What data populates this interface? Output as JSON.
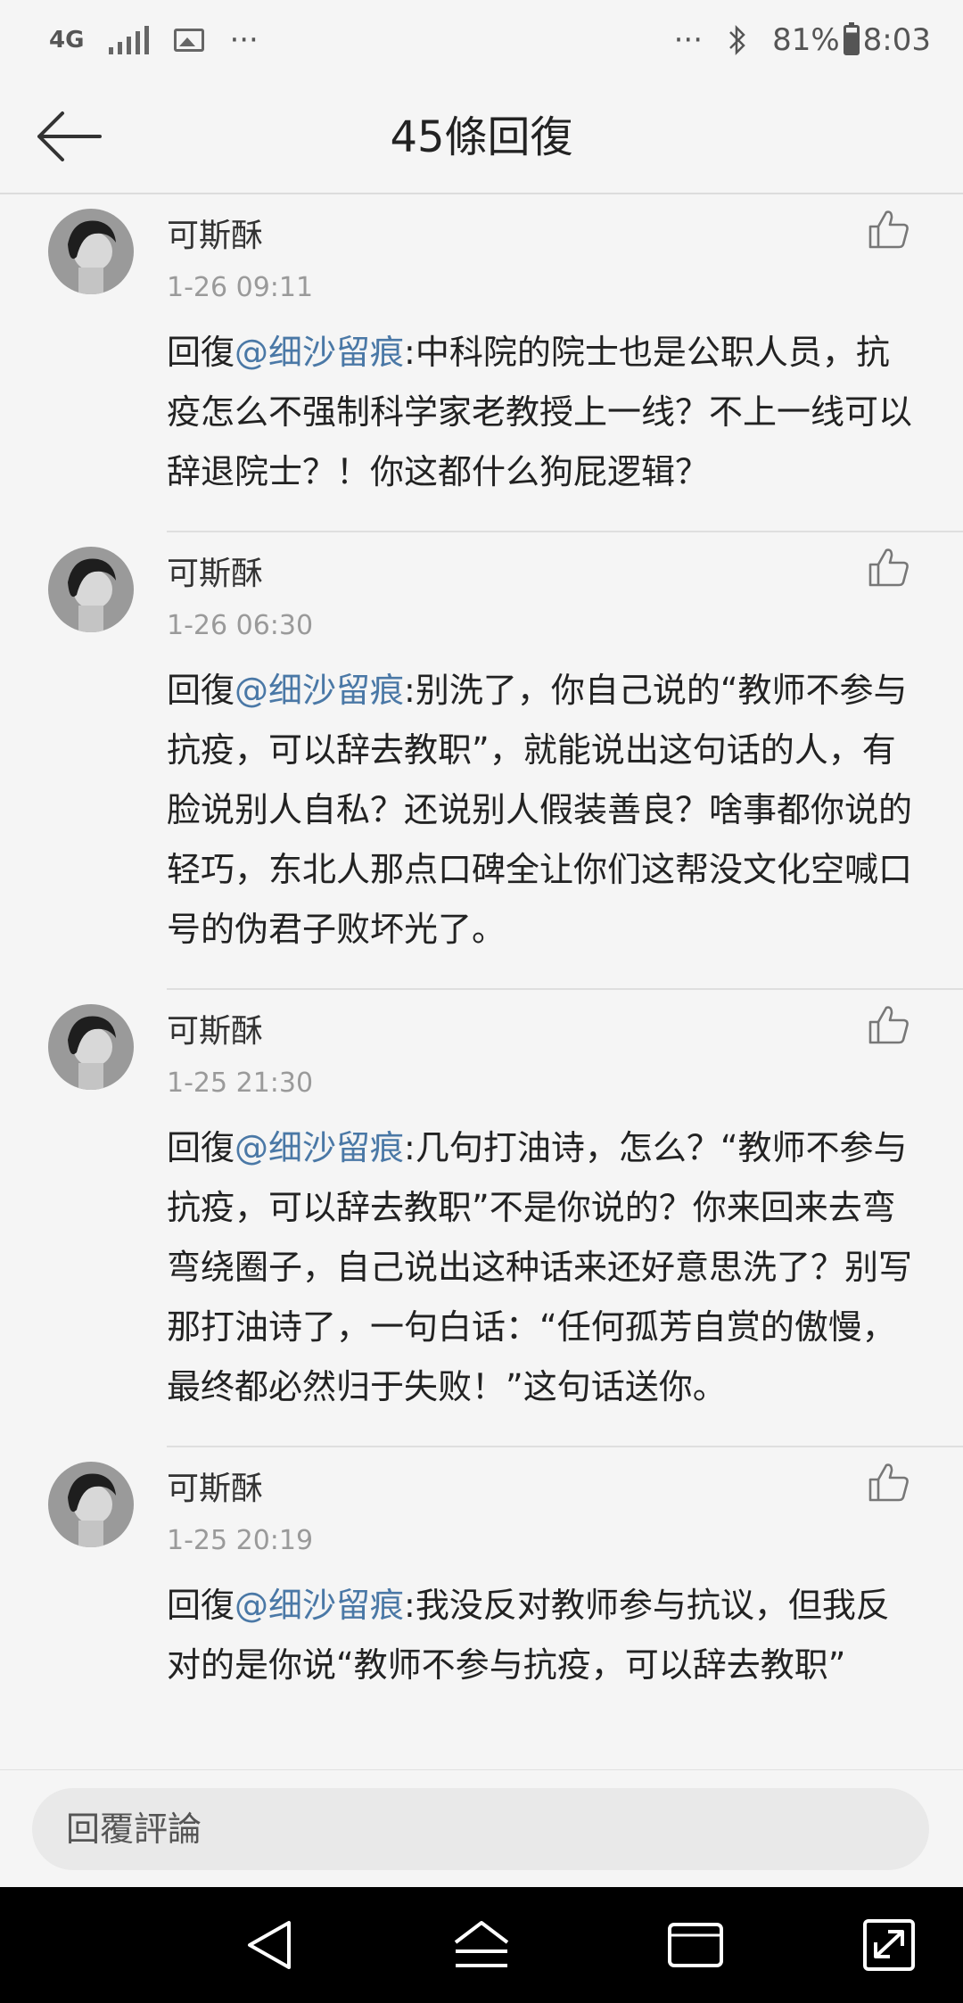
{
  "status_bar": {
    "network": "4G",
    "more": "···",
    "more_right": "···",
    "battery": "81%",
    "time": "8:03"
  },
  "header": {
    "title": "45條回復"
  },
  "comments": [
    {
      "author": "可斯酥",
      "time": "1-26 09:11",
      "reply_prefix": "回復",
      "mention": "@细沙留痕",
      "text": ":中科院的院士也是公职人员，抗疫怎么不强制科学家老教授上一线？不上一线可以辞退院士？！你这都什么狗屁逻辑？"
    },
    {
      "author": "可斯酥",
      "time": "1-26 06:30",
      "reply_prefix": "回復",
      "mention": "@细沙留痕",
      "text": ":别洗了，你自己说的“教师不参与抗疫，可以辞去教职”，就能说出这句话的人，有脸说别人自私？还说别人假装善良？啥事都你说的轻巧，东北人那点口碑全让你们这帮没文化空喊口号的伪君子败坏光了。"
    },
    {
      "author": "可斯酥",
      "time": "1-25 21:30",
      "reply_prefix": "回復",
      "mention": "@细沙留痕",
      "text": ":几句打油诗，怎么？“教师不参与抗疫，可以辞去教职”不是你说的？你来回来去弯弯绕圈子，自己说出这种话来还好意思洗了？别写那打油诗了，一句白话：“任何孤芳自赏的傲慢，最终都必然归于失败！”这句话送你。"
    },
    {
      "author": "可斯酥",
      "time": "1-25 20:19",
      "reply_prefix": "回復",
      "mention": "@细沙留痕",
      "text": ":我没反对教师参与抗议，但我反对的是你说“教师不参与抗疫，可以辞去教职”"
    }
  ],
  "reply": {
    "placeholder": "回覆評論"
  },
  "colors": {
    "mention": "#4a78a6",
    "background": "#f5f5f5",
    "nav_bar": "#000000"
  }
}
